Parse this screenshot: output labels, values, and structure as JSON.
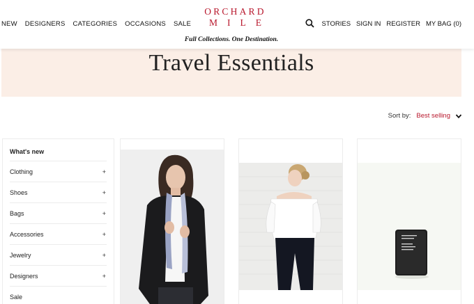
{
  "header": {
    "nav_left": [
      "NEW",
      "DESIGNERS",
      "CATEGORIES",
      "OCCASIONS",
      "SALE"
    ],
    "logo_line1": "ORCHARD",
    "logo_line2": "MILE",
    "tagline": "Full Collections. One Destination.",
    "nav_right": {
      "stories": "STORIES",
      "sign_in": "SIGN IN",
      "register": "REGISTER",
      "bag": "MY BAG (0)"
    }
  },
  "hero": {
    "title": "Travel Essentials"
  },
  "sort": {
    "label": "Sort by:",
    "value": "Best selling"
  },
  "sidebar": {
    "items": [
      {
        "label": "What's new",
        "expandable": false
      },
      {
        "label": "Clothing",
        "expandable": true,
        "toggle": "+"
      },
      {
        "label": "Shoes",
        "expandable": true,
        "toggle": "+"
      },
      {
        "label": "Bags",
        "expandable": true,
        "toggle": "+"
      },
      {
        "label": "Accessories",
        "expandable": true,
        "toggle": "+"
      },
      {
        "label": "Jewelry",
        "expandable": true,
        "toggle": "+"
      },
      {
        "label": "Designers",
        "expandable": true,
        "toggle": "+"
      },
      {
        "label": "Sale",
        "expandable": false
      }
    ]
  },
  "colors": {
    "brand": "#b8172c",
    "hero_bg": "#fbeee6"
  },
  "products": [
    {
      "image": "woman in black blazer with scarf"
    },
    {
      "image": "woman in white off-shoulder top"
    },
    {
      "image": "black leather passport cover"
    }
  ]
}
